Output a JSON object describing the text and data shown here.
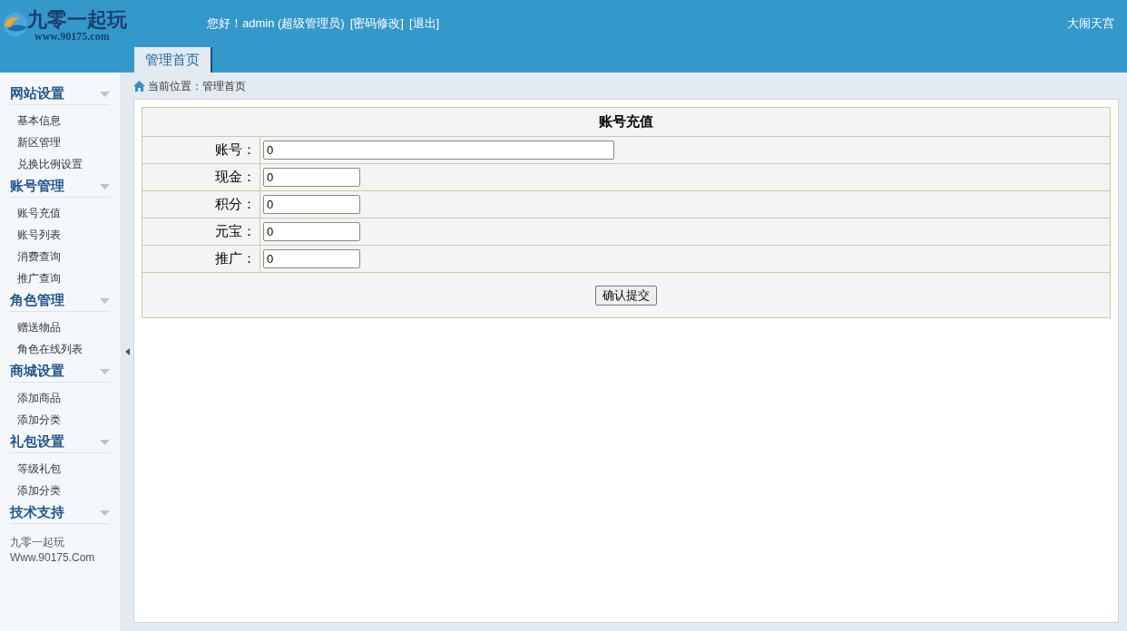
{
  "logo": {
    "name": "九零一起玩",
    "url": "www.90175.com"
  },
  "header": {
    "greeting": "您好！admin (超级管理员)",
    "links": [
      "[密码修改]",
      "[退出]"
    ],
    "server": "大闹天宫"
  },
  "tabs": [
    {
      "label": "管理首页",
      "selected": true
    }
  ],
  "sidebar": [
    {
      "title": "网站设置",
      "expanded": true,
      "items": [
        "基本信息",
        "新区管理",
        "兑换比例设置"
      ]
    },
    {
      "title": "账号管理",
      "expanded": true,
      "items": [
        "账号充值",
        "账号列表",
        "消费查询",
        "推广查询"
      ]
    },
    {
      "title": "角色管理",
      "expanded": true,
      "items": [
        "赠送物品",
        "角色在线列表"
      ]
    },
    {
      "title": "商城设置",
      "expanded": true,
      "items": [
        "添加商品",
        "添加分类"
      ]
    },
    {
      "title": "礼包设置",
      "expanded": true,
      "items": [
        "等级礼包",
        "添加分类"
      ]
    },
    {
      "title": "技术支持",
      "expanded": true
    }
  ],
  "sidebar_footer": [
    "九零一起玩",
    "Www.90175.Com"
  ],
  "breadcrumb": "当前位置：管理首页",
  "form": {
    "title": "账号充值",
    "fields": [
      {
        "label": "账号：",
        "value": "0",
        "kind": "wide"
      },
      {
        "label": "现金：",
        "value": "0",
        "kind": "short"
      },
      {
        "label": "积分：",
        "value": "0",
        "kind": "short"
      },
      {
        "label": "元宝：",
        "value": "0",
        "kind": "short"
      },
      {
        "label": "推广：",
        "value": "0",
        "kind": "short"
      }
    ],
    "submit": "确认提交"
  }
}
